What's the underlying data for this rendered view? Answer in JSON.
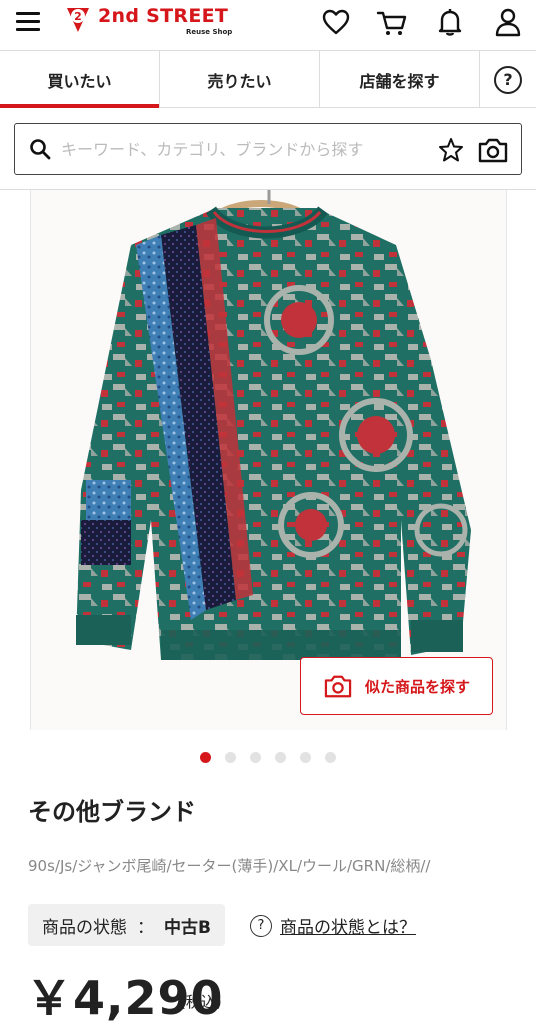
{
  "header": {
    "logo_text": "2nd STREET",
    "logo_sub": "Reuse Shop",
    "logo_mark": "2",
    "brand_color": "#d5171b",
    "icons": [
      "menu-icon",
      "heart-icon",
      "cart-icon",
      "bell-icon",
      "user-icon"
    ]
  },
  "tabs": {
    "buy": "買いたい",
    "sell": "売りたい",
    "store": "店舗を探す",
    "help": "?"
  },
  "search": {
    "placeholder": "キーワード、カテゴリ、ブランドから探す",
    "icons": [
      "search-icon",
      "star-icon",
      "camera-icon"
    ]
  },
  "product": {
    "similar_label": "似た商品を探す",
    "carousel": {
      "total": 6,
      "active_index": 0
    },
    "brand": "その他ブランド",
    "description": "90s/Js/ジャンボ尾崎/セーター(薄手)/XL/ウール/GRN/総柄//",
    "condition_label": "商品の状態",
    "condition_sep": "：",
    "condition_value": "中古B",
    "condition_help_icon": "?",
    "condition_help_link": "商品の状態とは？",
    "price": "￥4,290",
    "tax_note": "(税込)"
  }
}
